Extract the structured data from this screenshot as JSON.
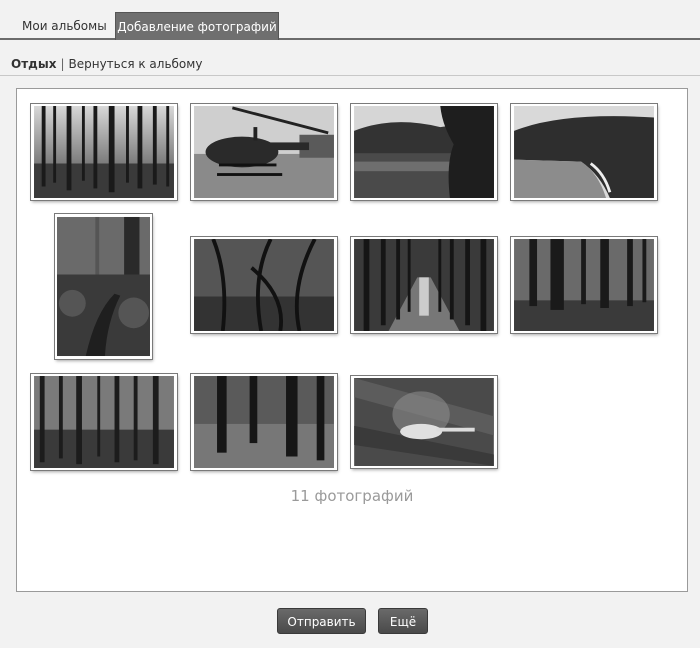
{
  "tabs": {
    "my_albums": "Мои альбомы",
    "add_photos": "Добавление фотографий"
  },
  "breadcrumb": {
    "album_name": "Отдых",
    "separator": "|",
    "back_link": "Вернуться к альбому"
  },
  "photos": [
    {
      "subject": "forest"
    },
    {
      "subject": "helicopter"
    },
    {
      "subject": "lake"
    },
    {
      "subject": "coast"
    },
    {
      "subject": "forest-path"
    },
    {
      "subject": "forest"
    },
    {
      "subject": "tree-alley"
    },
    {
      "subject": "forest"
    },
    {
      "subject": "forest"
    },
    {
      "subject": "forest"
    },
    {
      "subject": "helicopter-flight"
    }
  ],
  "photo_count_label": "11 фотографий",
  "buttons": {
    "send": "Отправить",
    "more": "Ещё"
  },
  "colors": {
    "active_tab": "#6f6f6f",
    "button": "#555555",
    "count_text": "#9a9a9a"
  }
}
